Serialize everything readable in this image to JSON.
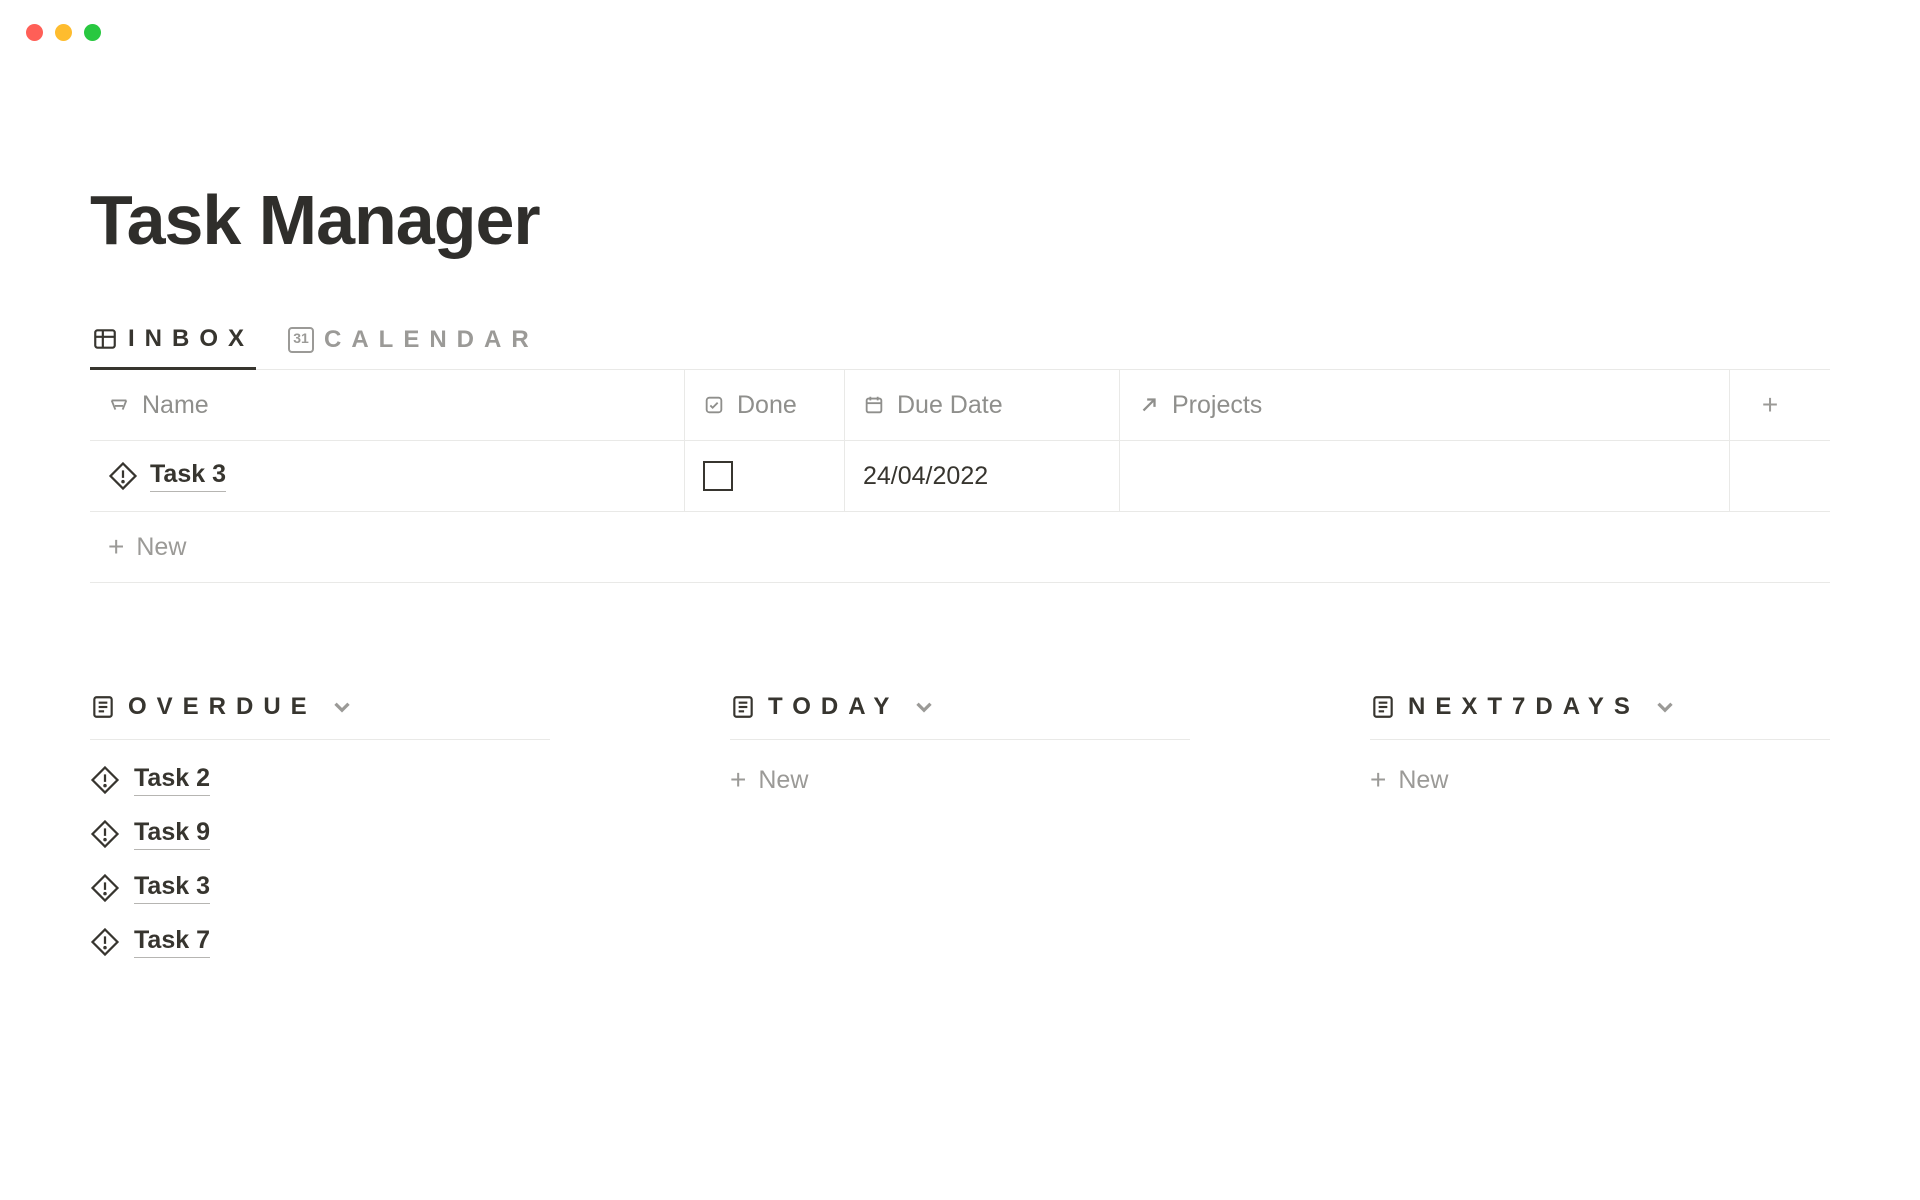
{
  "page_title": "Task Manager",
  "tabs": {
    "inbox": "INBOX",
    "calendar": "CALENDAR",
    "calendar_day": "31"
  },
  "columns": {
    "name": "Name",
    "done": "Done",
    "due": "Due Date",
    "projects": "Projects"
  },
  "inbox_rows": [
    {
      "name": "Task 3",
      "done": false,
      "due": "24/04/2022",
      "projects": ""
    }
  ],
  "new_label": "New",
  "lists": {
    "overdue": {
      "label": "OVERDUE",
      "items": [
        "Task 2",
        "Task 9",
        "Task 3",
        "Task 7"
      ]
    },
    "today": {
      "label": "TODAY",
      "items": []
    },
    "next7": {
      "label": "NEXT7DAYS",
      "items": []
    }
  }
}
